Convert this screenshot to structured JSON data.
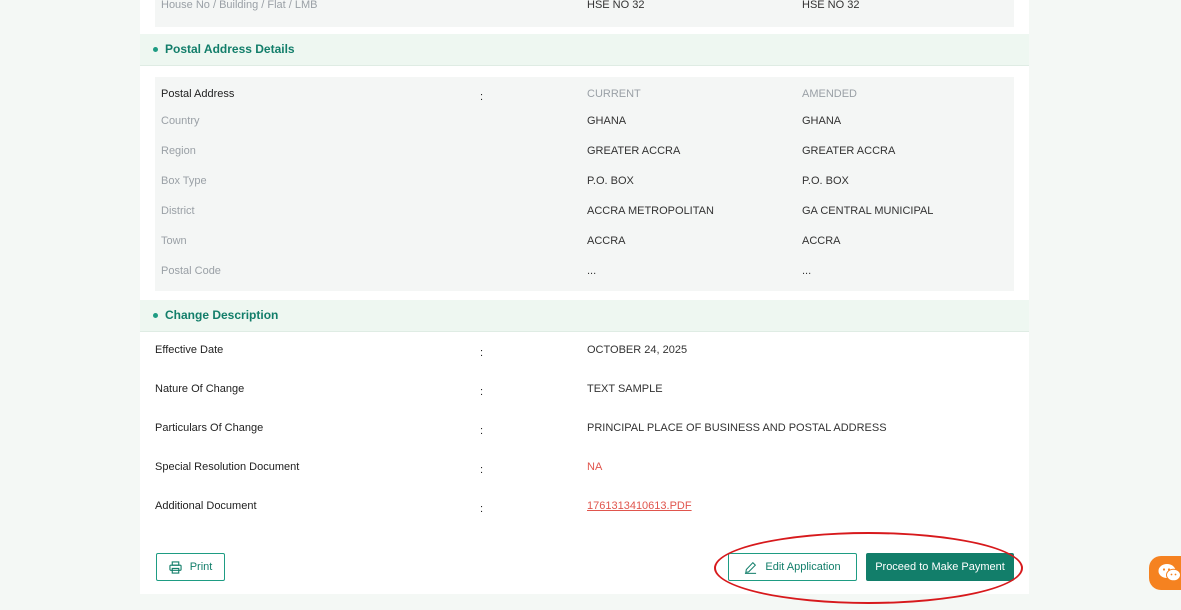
{
  "top_row": {
    "label": "House No / Building / Flat / LMB",
    "current": "HSE NO 32",
    "amended": "HSE NO 32"
  },
  "postal_section": {
    "title": "Postal Address Details",
    "header": {
      "label": "Postal Address",
      "colon": ":",
      "current": "CURRENT",
      "amended": "AMENDED"
    },
    "rows": [
      {
        "label": "Country",
        "current": "GHANA",
        "amended": "GHANA"
      },
      {
        "label": "Region",
        "current": "GREATER ACCRA",
        "amended": "GREATER ACCRA"
      },
      {
        "label": "Box Type",
        "current": "P.O. BOX",
        "amended": "P.O. BOX"
      },
      {
        "label": "District",
        "current": "ACCRA METROPOLITAN",
        "amended": "GA CENTRAL MUNICIPAL"
      },
      {
        "label": "Town",
        "current": "ACCRA",
        "amended": "ACCRA"
      },
      {
        "label": "Postal Code",
        "current": "...",
        "amended": "..."
      }
    ]
  },
  "change_section": {
    "title": "Change Description",
    "rows": [
      {
        "label": "Effective Date",
        "colon": ":",
        "value": "OCTOBER 24, 2025"
      },
      {
        "label": "Nature Of Change",
        "colon": ":",
        "value": "TEXT SAMPLE"
      },
      {
        "label": "Particulars Of Change",
        "colon": ":",
        "value": "PRINCIPAL PLACE OF BUSINESS AND POSTAL ADDRESS"
      },
      {
        "label": "Special Resolution Document",
        "colon": ":",
        "value": "NA"
      },
      {
        "label": "Additional Document",
        "colon": ":",
        "value": "1761313410613.PDF"
      }
    ]
  },
  "actions": {
    "print_label": "Print",
    "edit_label": "Edit Application",
    "pay_label": "Proceed to Make Payment"
  },
  "colors": {
    "accent": "#127e6a",
    "accent_light": "#1e9c83",
    "link_red": "#e0554d",
    "annotation_red": "#d7191c",
    "chat_orange": "#f58220"
  },
  "icons": {
    "print": "printer-icon",
    "edit": "pencil-icon",
    "chat": "wechat-icon"
  }
}
